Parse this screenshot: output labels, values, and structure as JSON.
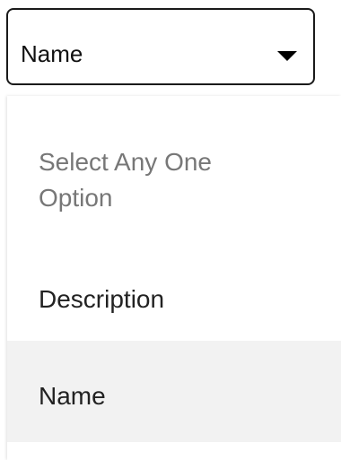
{
  "select": {
    "value": "Name",
    "caret_icon": "caret-down-icon"
  },
  "menu": {
    "placeholder": "Select Any One Option",
    "options": [
      {
        "label": "Description",
        "selected": false
      },
      {
        "label": "Name",
        "selected": true
      }
    ],
    "colors": {
      "selected_background": "#f2f2f2",
      "placeholder_text": "#777777"
    }
  }
}
